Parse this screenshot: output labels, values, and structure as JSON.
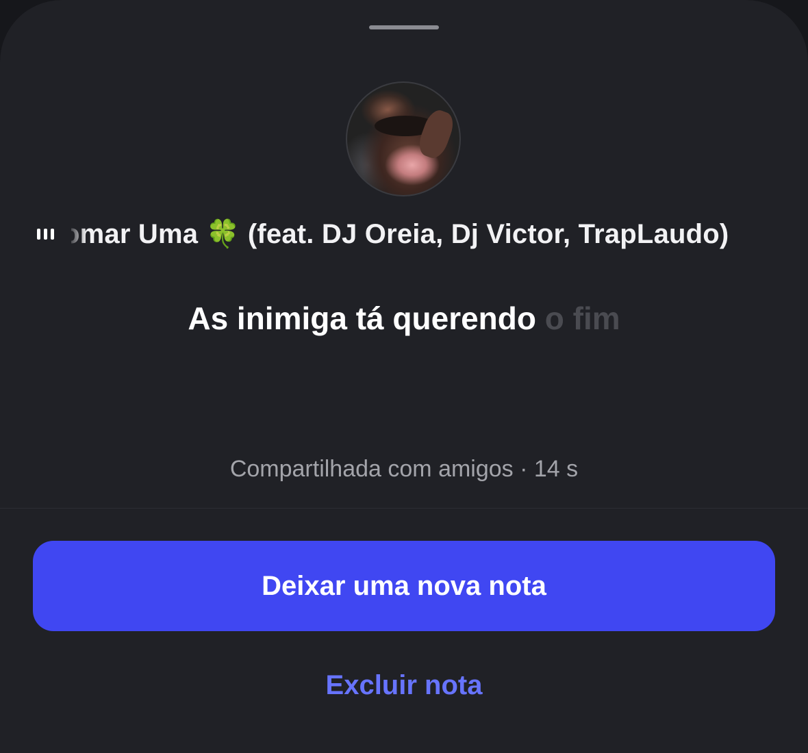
{
  "note": {
    "music_title": "omar Uma 🍀 (feat. DJ Oreia, Dj Victor, TrapLaudo)",
    "lyric_active": "As inimiga tá querendo",
    "lyric_upcoming": "o fim",
    "shared_status": "Compartilhada com amigos · 14 s"
  },
  "actions": {
    "new_note_label": "Deixar uma nova nota",
    "delete_note_label": "Excluir nota"
  },
  "icons": {
    "music": "audio-bars-icon",
    "handle": "sheet-grabber"
  },
  "colors": {
    "sheet_background": "#202126",
    "primary_button": "#4047f2",
    "link": "#6774ff",
    "secondary_text": "#a3a4aa"
  }
}
